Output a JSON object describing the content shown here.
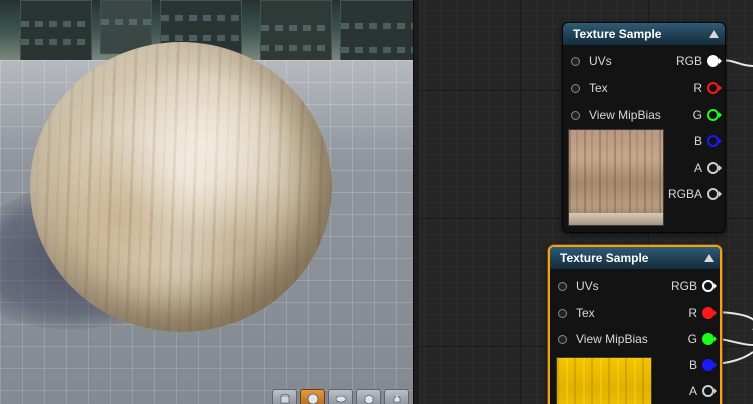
{
  "colors": {
    "node_border_selected": "#f0a21a",
    "pin_rgb": "#ffffff",
    "pin_r": "#ff1a1a",
    "pin_g": "#1aff1a",
    "pin_b": "#1a1aff",
    "pin_a": "#cfcfcf",
    "header_blue": "#2f5c76"
  },
  "viewport": {
    "toolbar_icons": [
      "cylinder-icon",
      "sphere-icon",
      "plane-icon",
      "cube-icon",
      "teapot-icon"
    ],
    "active_tool": "sphere-icon"
  },
  "graph": {
    "nodes": [
      {
        "title": "Texture Sample",
        "inputs": [
          "UVs",
          "Tex",
          "View MipBias"
        ],
        "outputs": [
          "RGB",
          "R",
          "G",
          "B",
          "A",
          "RGBA"
        ],
        "preview": "wood texture",
        "selected": false
      },
      {
        "title": "Texture Sample",
        "inputs": [
          "UVs",
          "Tex",
          "View MipBias"
        ],
        "outputs": [
          "RGB",
          "R",
          "G",
          "B",
          "A"
        ],
        "preview": "yellow texture",
        "selected": true
      }
    ]
  }
}
